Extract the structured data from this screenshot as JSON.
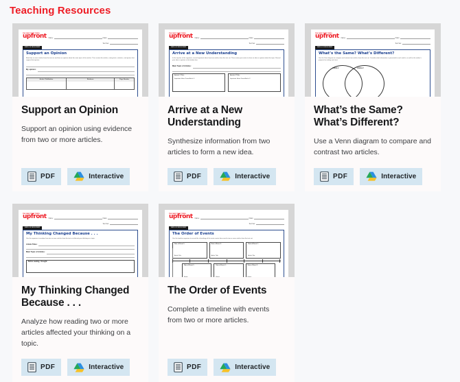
{
  "header": {
    "title": "Teaching Resources",
    "title_color": "#ee1c25"
  },
  "theme": {
    "page_background": "#f7f8fa",
    "card_background": "#fdfafa",
    "thumb_frame": "#d6d6d6",
    "button_background": "#d4e6f1",
    "sheet_title_color": "#1a3f8f"
  },
  "buttons": {
    "pdf_label": "PDF",
    "pdf_icon": "document-icon",
    "interactive_label": "Interactive",
    "interactive_icon": "google-drive-icon"
  },
  "worksheet_common": {
    "brand": "upfront",
    "brand_sup": "THE NEW YORK TIMES",
    "name_label": "Name:",
    "class_label": "Class:",
    "text_set_label": "Text Set:",
    "tag": "SKILLS BUILDER"
  },
  "cards": [
    {
      "title": "Support an Opinion",
      "description": "Support an opinion using evidence from two or more articles.",
      "sheet": {
        "title": "Support an Opinion",
        "subtitle": "Read two or more articles from the text set and form an opinion about the main topic of the articles. Then review the articles, noting facts, statistics, and quotes that support that opinion.",
        "opinion_label": "My opinion:",
        "table_headers": [
          "Article Title/Author",
          "Evidence",
          "Page Number"
        ]
      }
    },
    {
      "title": "Arrive at a New Understanding",
      "description": "Synthesize information from two articles to form a new idea.",
      "sheet": {
        "title": "Arrive at a New Understanding",
        "subtitle": "In the top box of the organizer, record important ideas from two articles from the text set. Then review your notes to form an idea or opinion about the topic. Record your idea or opinion in the bottom box.",
        "topic_label": "Main Topic of Articles:",
        "box1_title": "Article 1 Title:",
        "box1_sub": "Important Ideas From Article 1:",
        "box2_title": "Article 2 Title:",
        "box2_sub": "Important Ideas From Article 2:"
      }
    },
    {
      "title": "What’s the Same? What’s Different?",
      "description": "Use a Venn diagram to compare and contrast two articles.",
      "sheet": {
        "title": "What’s the Same? What’s Different?",
        "subtitle": "Use the Venn diagram to compare and contrast two articles from the text set. Consider what information is presented in each article, as well as the author’s purpose for writing each text.",
        "venn_left_label": "Article 1",
        "venn_right_label": "Article 2"
      }
    },
    {
      "title": "My Thinking Changed Because . . .",
      "description": "Analyze how reading two or more articles affected your thinking on a topic.",
      "sheet": {
        "title": "My Thinking Changed Because . . .",
        "subtitle": "Use the organizer to analyze how two or more articles from the text set affected your thinking on a topic.",
        "titles_label": "Article Titles:",
        "topic_label": "Main Topic of Articles:",
        "before_label": "Before reading, I thought:"
      }
    },
    {
      "title": "The Order of Events",
      "description": "Complete a timeline with events from two or more articles.",
      "sheet": {
        "title": "The Order of Events",
        "subtitle": "Use the timeline organizer to record the chronology of the main events discussed in two or more articles from the text set.",
        "box_title": "Date of Event 1:",
        "box_sub": "Event:",
        "box_note": "Article Title:"
      }
    }
  ]
}
